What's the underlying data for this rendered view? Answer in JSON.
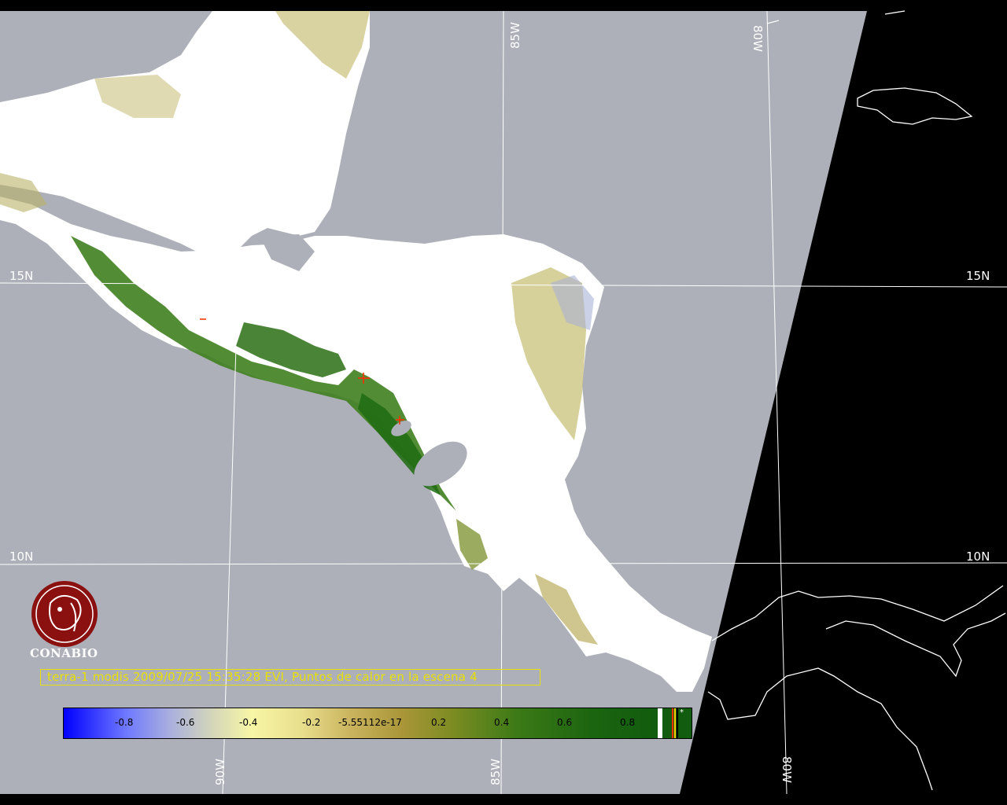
{
  "map": {
    "grid_labels": {
      "lon_85w_top": "85W",
      "lon_80w_top": "80W",
      "lon_90w_bottom": "90W",
      "lon_85w_bottom": "85W",
      "lon_80w_bottom": "80W",
      "lat_15n_left": "15N",
      "lat_15n_right": "15N",
      "lat_10n_left": "10N",
      "lat_10n_right": "10N"
    },
    "colors": {
      "ocean": "#adb0b8",
      "no_data": "#000000",
      "cloud": "#ffffff",
      "grid": "#ffffff",
      "vegetation_high": "#1f6b12",
      "vegetation_mid": "#b8b060",
      "caption": "#e8e000"
    }
  },
  "logo": {
    "name": "CONABIO"
  },
  "caption": {
    "text": "terra-1 modis 2009/07/25 15:35:28 EVI, Puntos de calor en la escena 4"
  },
  "colorbar": {
    "ticks": [
      "-0.8",
      "-0.6",
      "-0.4",
      "-0.2",
      "-5.55112e-17",
      "0.2",
      "0.4",
      "0.6",
      "0.8"
    ],
    "extra_mark": "*"
  }
}
